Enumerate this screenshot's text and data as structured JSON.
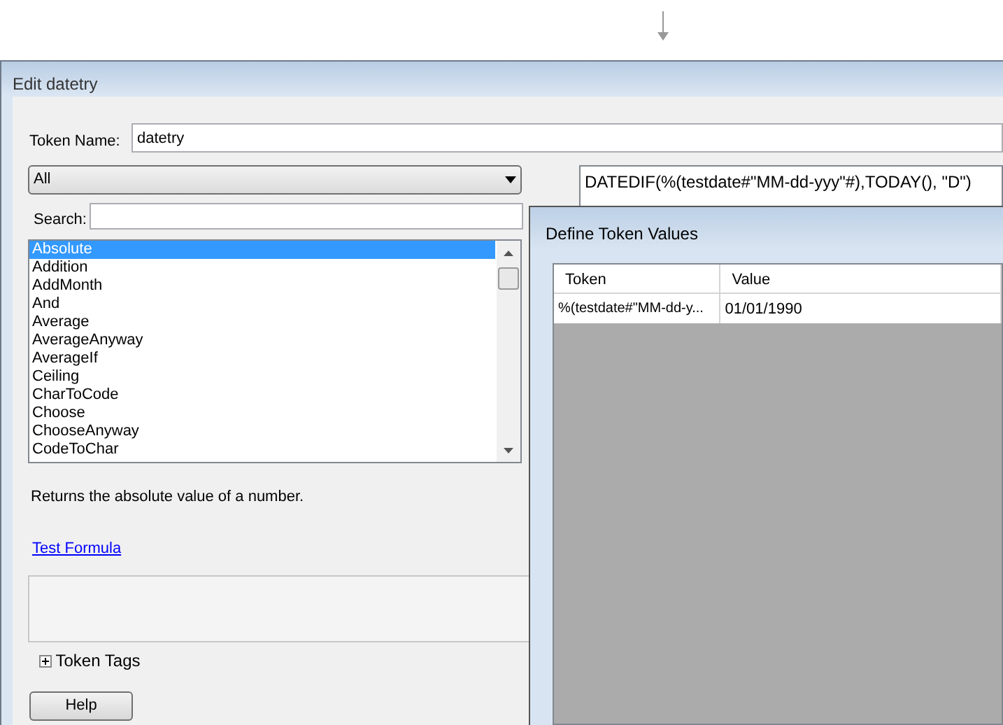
{
  "edit_dialog": {
    "title": "Edit datetry",
    "token_name": {
      "label": "Token Name:",
      "value": "datetry"
    },
    "category_dropdown": {
      "value": "All"
    },
    "search": {
      "label": "Search:"
    },
    "functions": [
      {
        "label": "Absolute",
        "selected": true
      },
      {
        "label": "Addition",
        "selected": false
      },
      {
        "label": "AddMonth",
        "selected": false
      },
      {
        "label": "And",
        "selected": false
      },
      {
        "label": "Average",
        "selected": false
      },
      {
        "label": "AverageAnyway",
        "selected": false
      },
      {
        "label": "AverageIf",
        "selected": false
      },
      {
        "label": "Ceiling",
        "selected": false
      },
      {
        "label": "CharToCode",
        "selected": false
      },
      {
        "label": "Choose",
        "selected": false
      },
      {
        "label": "ChooseAnyway",
        "selected": false
      },
      {
        "label": "CodeToChar",
        "selected": false
      }
    ],
    "description": "Returns the absolute value of a number.",
    "test_link": "Test Formula",
    "token_tags": {
      "label": "Token Tags",
      "expanded": false
    },
    "help_button": "Help",
    "formula": "DATEDIF(%(testdate#\"MM-dd-yyy\"#),TODAY(), \"D\")"
  },
  "define_dialog": {
    "title": "Define Token Values",
    "columns": [
      "Token",
      "Value"
    ],
    "rows": [
      {
        "token": "%(testdate#\"MM-dd-y...",
        "value": "01/01/1990"
      }
    ]
  }
}
